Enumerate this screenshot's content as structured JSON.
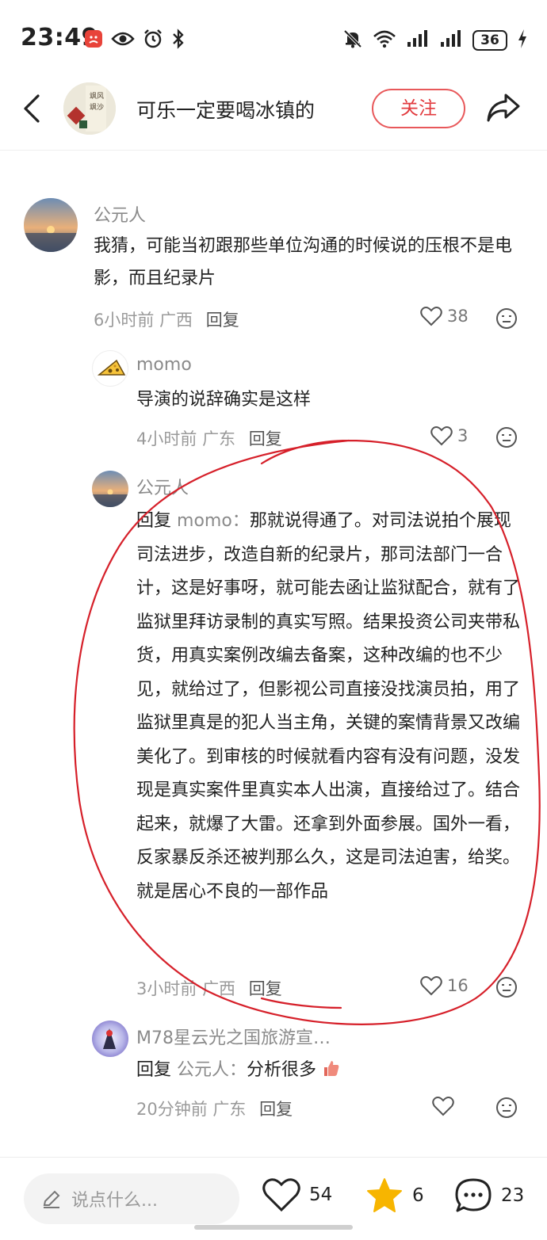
{
  "status_bar": {
    "time": "23:49",
    "battery": "36",
    "icons": [
      "red-app-notification-icon",
      "eye-icon",
      "alarm-icon",
      "bluetooth-icon",
      "mute-bell-icon",
      "wifi-icon",
      "signal-icon",
      "signal-icon",
      "charging-icon"
    ]
  },
  "header": {
    "title": "可乐一定要喝冰镇的",
    "follow_label": "关注"
  },
  "comments": [
    {
      "name": "公元人",
      "text": "我猜，可能当初跟那些单位沟通的时候说的压根不是电影，而且纪录片",
      "time": "6小时前",
      "region": "广西",
      "reply_label": "回复",
      "likes": "38"
    },
    {
      "name": "momo",
      "text": "导演的说辞确实是这样",
      "time": "4小时前",
      "region": "广东",
      "reply_label": "回复",
      "likes": "3"
    },
    {
      "name": "公元人",
      "reply_prefix": "回复",
      "reply_to": "momo：",
      "text": "那就说得通了。对司法说拍个展现司法进步，改造自新的纪录片，那司法部门一合计，这是好事呀，就可能去函让监狱配合，就有了监狱里拜访录制的真实写照。结果投资公司夹带私货，用真实案例改编去备案，这种改编的也不少见，就给过了，但影视公司直接没找演员拍，用了监狱里真是的犯人当主角，关键的案情背景又改编美化了。到审核的时候就看内容有没有问题，没发现是真实案件里真实本人出演，直接给过了。结合起来，就爆了大雷。还拿到外面参展。国外一看，反家暴反杀还被判那么久，这是司法迫害，给奖。就是居心不良的一部作品",
      "time": "3小时前",
      "region": "广西",
      "reply_label": "回复",
      "likes": "16"
    },
    {
      "name": "M78星云光之国旅游宣…",
      "reply_prefix": "回复",
      "reply_to": "公元人：",
      "text": "分析很多",
      "time": "20分钟前",
      "region": "广东",
      "reply_label": "回复",
      "likes": ""
    }
  ],
  "bottom_bar": {
    "input_placeholder": "说点什么...",
    "likes": "54",
    "stars": "6",
    "comments": "23"
  },
  "colors": {
    "accent_red": "#e23b3f",
    "star_yellow": "#f7b500",
    "annotation_red": "#d6202a"
  }
}
